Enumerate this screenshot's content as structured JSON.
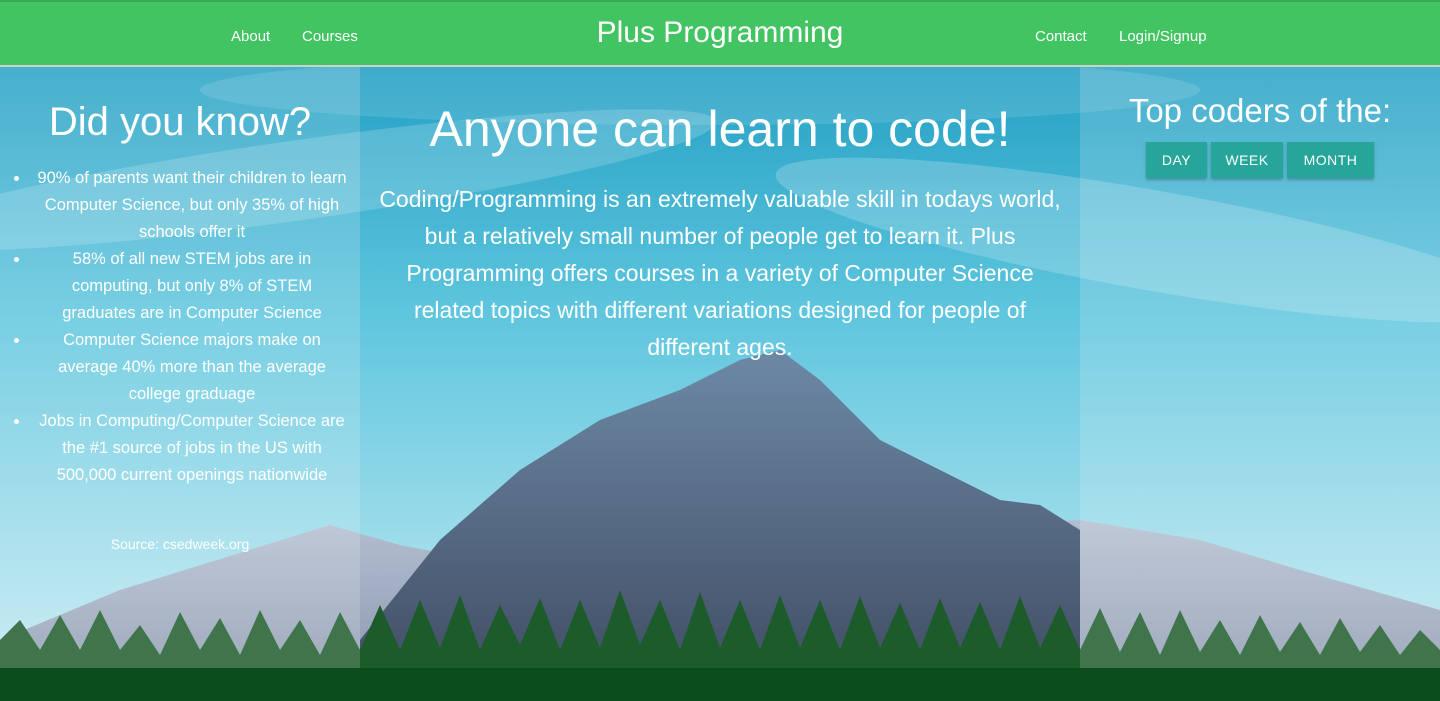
{
  "nav": {
    "brand": "Plus Programming",
    "left_links": [
      "About",
      "Courses"
    ],
    "right_links": [
      "Contact",
      "Login/Signup"
    ]
  },
  "left_panel": {
    "title": "Did you know?",
    "facts": [
      "90% of parents want their children to learn Computer Science, but only 35% of high schools offer it",
      "58% of all new STEM jobs are in computing, but only 8% of STEM graduates are in Computer Science",
      "Computer Science majors make on average 40% more than the average college graduage",
      "Jobs in Computing/Computer Science are the #1 source of jobs in the US with 500,000 current openings nationwide"
    ],
    "source": "Source: csedweek.org"
  },
  "center_panel": {
    "title": "Anyone can learn to code!",
    "text": "Coding/Programming is an extremely valuable skill in todays world, but a relatively small number of people get to learn it. Plus Programming offers courses in a variety of Computer Science related topics with different variations designed for people of different ages."
  },
  "right_panel": {
    "title": "Top coders of the:",
    "buttons": [
      "DAY",
      "WEEK",
      "MONTH"
    ]
  },
  "colors": {
    "navbar": "#43c463",
    "button": "#26a69a",
    "sky_top": "#1aa0c8",
    "mountain": "#4f5f78",
    "forest": "#0b4d1a"
  }
}
